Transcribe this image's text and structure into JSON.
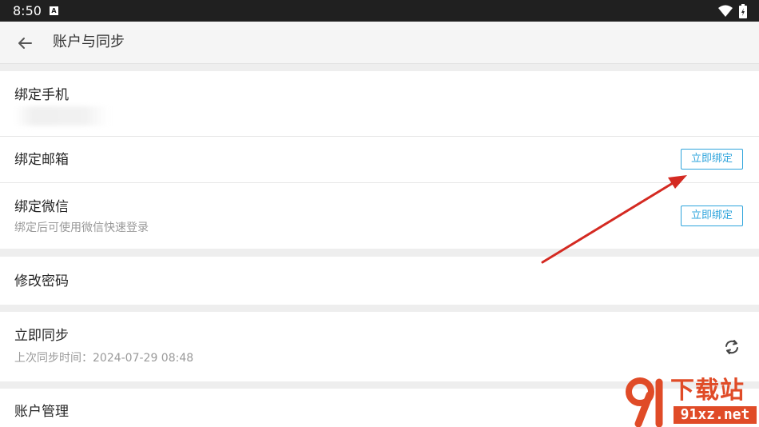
{
  "status_bar": {
    "time": "8:50"
  },
  "app_bar": {
    "title": "账户与同步",
    "back_icon": "arrow-left-icon"
  },
  "bind_phone": {
    "title": "绑定手机"
  },
  "bind_email": {
    "title": "绑定邮箱",
    "button": "立即绑定"
  },
  "bind_wechat": {
    "title": "绑定微信",
    "subtitle": "绑定后可使用微信快速登录",
    "button": "立即绑定"
  },
  "change_password": {
    "title": "修改密码"
  },
  "sync_now": {
    "title": "立即同步",
    "subtitle": "上次同步时间：2024-07-29 08:48",
    "icon": "sync-icon"
  },
  "account_manage": {
    "title": "账户管理"
  },
  "watermark": {
    "brand": "下载站",
    "url": "91xz.net"
  },
  "colors": {
    "accent": "#2ea4dc",
    "arrow": "#d42a22",
    "watermark": "#e04b27"
  }
}
